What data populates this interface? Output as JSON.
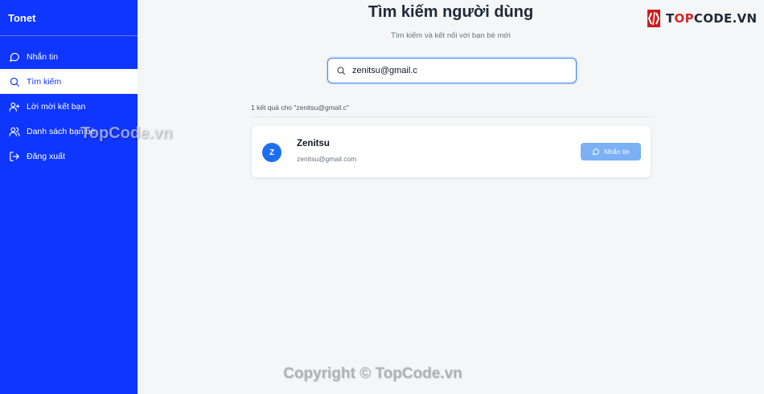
{
  "sidebar": {
    "brand": "Tonet",
    "items": [
      {
        "label": "Nhắn tin",
        "icon": "chat-bubble-icon",
        "active": false
      },
      {
        "label": "Tìm kiếm",
        "icon": "search-icon",
        "active": true
      },
      {
        "label": "Lời mời kết bạn",
        "icon": "user-plus-icon",
        "active": false
      },
      {
        "label": "Danh sách bạn bè",
        "icon": "users-icon",
        "active": false
      },
      {
        "label": "Đăng xuất",
        "icon": "logout-icon",
        "active": false
      }
    ]
  },
  "main": {
    "title": "Tìm kiếm người dùng",
    "subtitle": "Tìm kiếm và kết nối với bạn bè mới",
    "search": {
      "value": "zenitsu@gmail.c"
    },
    "result_count": "1 kết quả cho \"zenitsu@gmail.c\"",
    "results": [
      {
        "avatar_initial": "Z",
        "name": "Zenitsu",
        "email": "zenitsu@gmail.com",
        "action_label": "Nhắn tin"
      }
    ]
  },
  "watermarks": {
    "logo_prefix": "T",
    "logo_accent": "OP",
    "logo_rest": "CODE.VN",
    "middle": "TopCode.vn",
    "bottom": "Copyright © TopCode.vn"
  },
  "colors": {
    "sidebar_bg": "#0f36ff",
    "accent": "#3b82f6",
    "avatar_bg": "#1d6ff2",
    "button_bg": "#7bb0f5"
  }
}
